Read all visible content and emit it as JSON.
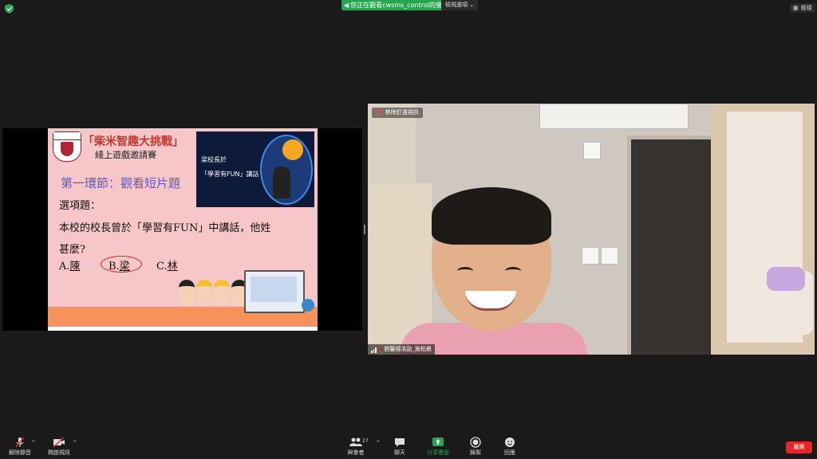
{
  "topbar": {
    "viewing_banner": "您正在觀看cwsms_control的螢幕",
    "view_options": "檢視選項 ⌄",
    "view_mode": "檢視"
  },
  "slide": {
    "title": "「柴米智趣大挑戰」",
    "subtitle": "綫上遊戲邀請賽",
    "inset_line1": "梁校長於",
    "inset_line2": "「學習有FUN」講話",
    "round_title": "第一環節：觀看短片題",
    "question_type": "選項題：",
    "question_line1": "本校的校長曾於「學習有FUN」中講話，他姓",
    "question_line2": "甚麼?",
    "options": [
      {
        "prefix": "A.",
        "text": "陳"
      },
      {
        "prefix": "B.",
        "text": "梁"
      },
      {
        "prefix": "C.",
        "text": "林"
      }
    ]
  },
  "video": {
    "unpin_label": "移除釘選視訊",
    "participant_name": "劉鑿禧洛劭_施柏晨"
  },
  "toolbar": {
    "mute": "解除靜音",
    "video": "開啟視訊",
    "participants": "與會者",
    "participants_count": "27",
    "chat": "聊天",
    "share": "分享畫面",
    "record": "錄製",
    "reactions": "回應",
    "end": "離開"
  },
  "colors": {
    "share_green": "#26a650",
    "end_red": "#e02828",
    "slide_pink": "#f6c6c9",
    "slide_orange": "#f6935c",
    "title_red": "#c0392b",
    "round_blue": "#5a5ad0"
  }
}
